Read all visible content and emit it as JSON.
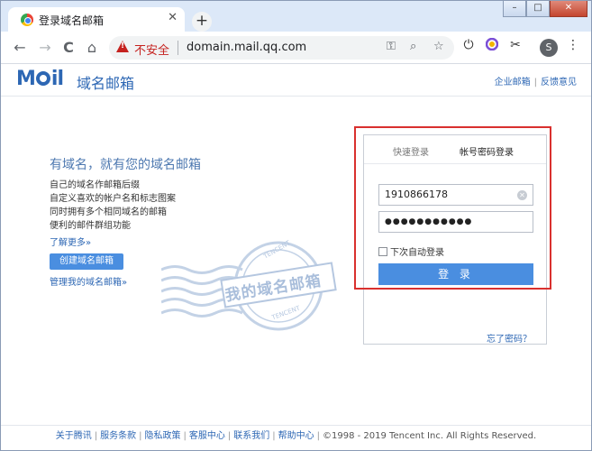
{
  "browser": {
    "tab_title": "登录域名邮箱",
    "tab_close": "✕",
    "new_tab": "+",
    "nav": {
      "back": "←",
      "forward": "→",
      "reload": "C",
      "home": "⌂"
    },
    "insecure_label": "不安全",
    "url": "domain.mail.qq.com",
    "profile_initial": "S",
    "window_controls": [
      "–",
      "□",
      "✕"
    ],
    "icons": {
      "key": "key-icon",
      "zoom": "search-icon",
      "bookmark": "star-icon",
      "power": "power-icon",
      "ext": "extension-icon",
      "cut": "scissors-icon",
      "menu": "kebab-menu-icon"
    }
  },
  "site": {
    "logo_text": "域名邮箱",
    "header_links": [
      "企业邮箱",
      "反馈意见"
    ]
  },
  "promo": {
    "headline": "有域名，就有您的域名邮箱",
    "features": [
      "自己的域名作邮箱后缀",
      "自定义喜欢的帐户名和标志图案",
      "同时拥有多个相同域名的邮箱",
      "便利的邮件群组功能"
    ],
    "learn_more": "了解更多»",
    "create_button": "创建域名邮箱",
    "manage_link": "管理我的域名邮箱»",
    "stamp_text": "我的域名邮箱",
    "stamp_ring_text": "TENCENT"
  },
  "login": {
    "tabs": [
      "快速登录",
      "帐号密码登录"
    ],
    "account_value": "1910866178",
    "password_value": "●●●●●●●●●●●",
    "remember_label": "下次自动登录",
    "remember_checked": false,
    "login_button": "登 录",
    "forgot_link": "忘了密码？"
  },
  "footer": {
    "links": [
      "关于腾讯",
      "服务条款",
      "隐私政策",
      "客服中心",
      "联系我们",
      "帮助中心"
    ],
    "copyright": "©1998 - 2019 Tencent Inc. All Rights Reserved."
  },
  "colors": {
    "accent": "#4a8ee0",
    "link": "#2d67b4",
    "highlight": "#d9302e",
    "warning": "#c5221f"
  }
}
